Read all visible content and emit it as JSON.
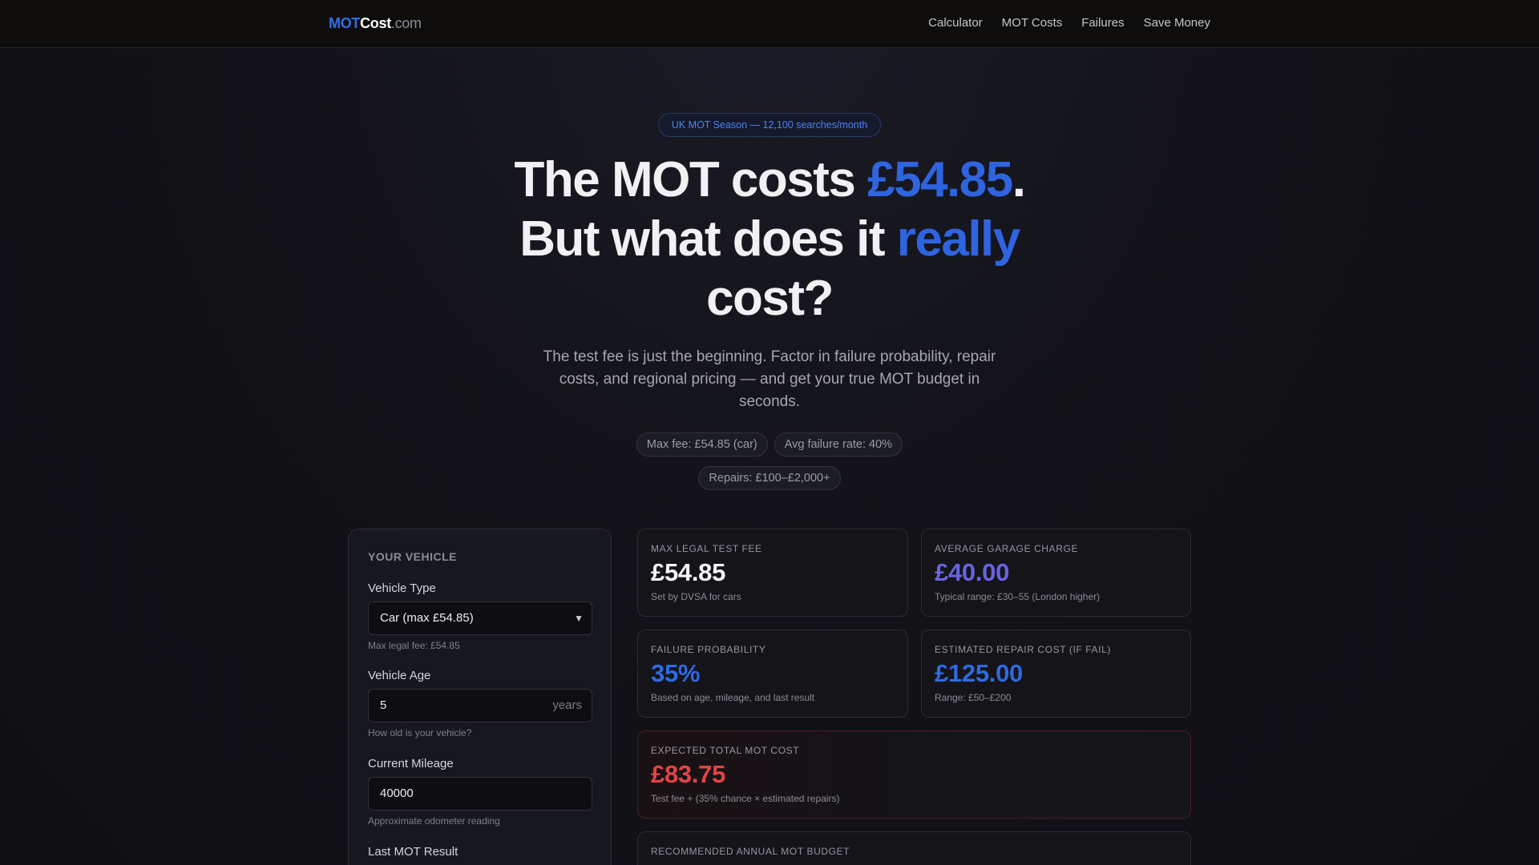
{
  "nav": {
    "logo": {
      "part1": "MOT",
      "part2": "Cost",
      "part3": ".com"
    },
    "links": [
      "Calculator",
      "MOT Costs",
      "Failures",
      "Save Money"
    ]
  },
  "hero": {
    "pill": "UK MOT Season — 12,100 searches/month",
    "title_a": "The MOT costs ",
    "title_price": "£54.85",
    "title_b": ".",
    "title_c": "But what does it ",
    "title_really": "really",
    "title_d": "cost?",
    "subtitle": "The test fee is just the beginning. Factor in failure probability, repair costs, and regional pricing — and get your true MOT budget in seconds.",
    "chips": [
      "Max fee: £54.85 (car)",
      "Avg failure rate: 40%",
      "Repairs: £100–£2,000+"
    ]
  },
  "form": {
    "title": "YOUR VEHICLE",
    "vehicle_type": {
      "label": "Vehicle Type",
      "value": "Car (max £54.85)",
      "hint": "Max legal fee: £54.85"
    },
    "vehicle_age": {
      "label": "Vehicle Age",
      "value": "5",
      "suffix": "years",
      "hint": "How old is your vehicle?"
    },
    "mileage": {
      "label": "Current Mileage",
      "value": "40000",
      "hint": "Approximate odometer reading"
    },
    "last_result": {
      "label": "Last MOT Result"
    }
  },
  "cards": {
    "max_fee": {
      "label": "MAX LEGAL TEST FEE",
      "value": "£54.85",
      "note": "Set by DVSA for cars"
    },
    "garage": {
      "label": "AVERAGE GARAGE CHARGE",
      "value": "£40.00",
      "note": "Typical range: £30–55 (London higher)"
    },
    "failure": {
      "label": "FAILURE PROBABILITY",
      "value": "35%",
      "note": "Based on age, mileage, and last result"
    },
    "repair": {
      "label": "ESTIMATED REPAIR COST (IF FAIL)",
      "value": "£125.00",
      "note": "Range: £50–£200"
    },
    "expected": {
      "label": "EXPECTED TOTAL MOT COST",
      "value": "£83.75",
      "note": "Test fee + (35% chance × estimated repairs)"
    },
    "budget": {
      "label": "RECOMMENDED ANNUAL MOT BUDGET"
    }
  },
  "colors": {
    "accent_blue": "#2f64e0",
    "accent_purple": "#6a63e0",
    "accent_red": "#e04545",
    "background": "#121218"
  }
}
